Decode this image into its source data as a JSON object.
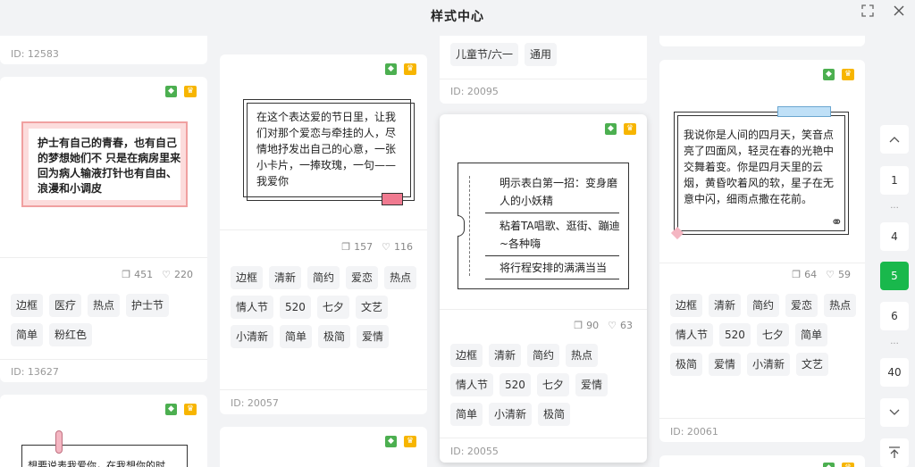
{
  "window": {
    "title": "样式中心"
  },
  "cards": {
    "c1": {
      "id": "ID: 12583"
    },
    "c2": {
      "text": "护士有自己的青春，也有自己的梦想她们不 只是在病房里来回为病人输液打针也有自由、 浪漫和小调皮",
      "copies": "451",
      "likes": "220",
      "tags": [
        "边框",
        "医疗",
        "热点",
        "护士节",
        "简单",
        "粉红色"
      ],
      "id": "ID: 13627"
    },
    "c3": {
      "text": "想要说表我爱你，在我想你的时"
    },
    "c4": {
      "text": "在这个表达爱的节日里，让我们对那个爱恋与牵挂的人，尽情地抒发出自己的心意，一张小卡片，一捧玫瑰，一句——我爱你",
      "copies": "157",
      "likes": "116",
      "tags": [
        "边框",
        "清新",
        "简约",
        "爱恋",
        "热点",
        "情人节",
        "520",
        "七夕",
        "文艺",
        "小清新",
        "简单",
        "极简",
        "爱情"
      ],
      "id": "ID: 20057"
    },
    "c6": {
      "tags": [
        "儿童节/六一",
        "通用"
      ],
      "id": "ID: 20095"
    },
    "c7": {
      "lines": [
        "明示表白第一招：变身磨人的小妖精",
        "粘着TA唱歌、逛街、蹦迪~各种嗨",
        "将行程安排的满满当当"
      ],
      "copies": "90",
      "likes": "63",
      "tags": [
        "边框",
        "清新",
        "简约",
        "热点",
        "情人节",
        "520",
        "七夕",
        "爱情",
        "简单",
        "小清新",
        "极简"
      ],
      "id": "ID: 20055"
    },
    "c9": {
      "text": "我说你是人间的四月天，笑音点亮了四面风，轻灵在春的光艳中交舞着变。你是四月天里的云烟，黄昏吹着风的软，星子在无意中闪，细雨点撒在花前。",
      "copies": "64",
      "likes": "59",
      "tags": [
        "边框",
        "清新",
        "简约",
        "爱恋",
        "热点",
        "情人节",
        "520",
        "七夕",
        "简单",
        "极简",
        "爱情",
        "小清新",
        "文艺"
      ],
      "id": "ID: 20061"
    }
  },
  "pagination": {
    "pages": [
      "1",
      "4",
      "5",
      "6",
      "40"
    ],
    "ellipsis": "...",
    "current": "5"
  },
  "icons": {
    "bookmark": "bookmark-icon",
    "crown": "crown-icon",
    "copy": "copy-icon",
    "heart": "heart-icon"
  },
  "colors": {
    "accent": "#19b84c",
    "bookmark": "#4caf50",
    "crown": "#f7b500",
    "pink": "#f4a6a6"
  }
}
